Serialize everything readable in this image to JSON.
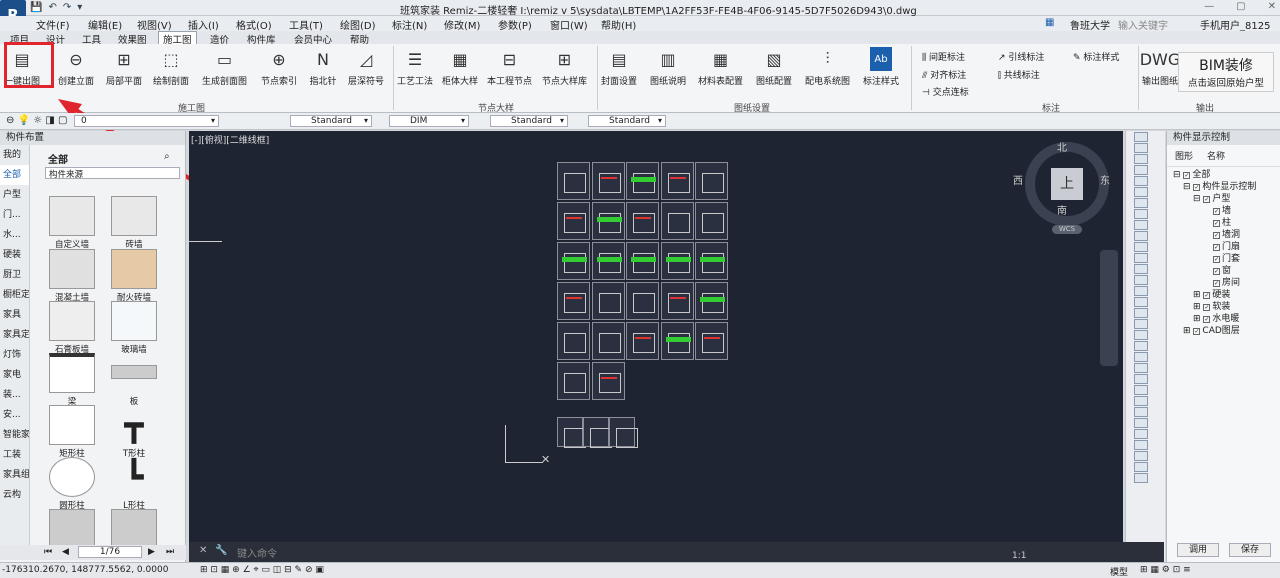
{
  "app": {
    "title": "班筑家装 Remiz-二楼轻奢    I:\\remiz v 5\\sysdata\\LBTEMP\\1A2FF53F-FE4B-4F06-9145-5D7F5026D943\\0.dwg",
    "logo": "R"
  },
  "menus": [
    "文件(F)",
    "编辑(E)",
    "视图(V)",
    "插入(I)",
    "格式(O)",
    "工具(T)",
    "绘图(D)",
    "标注(N)",
    "修改(M)",
    "参数(P)",
    "窗口(W)",
    "帮助(H)"
  ],
  "top_right": {
    "school": "鲁班大学",
    "search_placeholder": "输入关键字",
    "user": "手机用户_8125"
  },
  "tabs": [
    "项目",
    "设计",
    "工具",
    "效果图",
    "施工图",
    "造价",
    "构件库",
    "会员中心",
    "帮助"
  ],
  "active_tab": "施工图",
  "ribbon": {
    "construction": [
      "一键出图",
      "创建立面",
      "局部平面",
      "绘制剖面",
      "生成剖面图",
      "节点索引",
      "指北针",
      "层深符号"
    ],
    "construction_label": "施工图",
    "node": [
      "工艺工法",
      "柜体大样",
      "本工程节点",
      "节点大样库"
    ],
    "node_label": "节点大样",
    "drawing_settings": [
      "封面设置",
      "图纸说明",
      "材料表配置",
      "图纸配置",
      "配电系统图",
      "标注样式"
    ],
    "drawing_settings_label": "图纸设置",
    "annotate": [
      "间距标注",
      "对齐标注",
      "交点连标",
      "引线标注",
      "共线标注",
      "标注样式"
    ],
    "annotate_label": "标注",
    "output": [
      "输出图纸"
    ],
    "output_label": "输出"
  },
  "bim_tip": {
    "title": "BIM装修",
    "sub": "点击返回原始户型"
  },
  "propbar": {
    "layer": "0",
    "text_style": "Standard",
    "dim_style": "DIM",
    "table_style": "Standard",
    "mleader_style": "Standard"
  },
  "left_panel": {
    "title": "构件布置",
    "categories": [
      "我的",
      "全部",
      "户型",
      "门...",
      "水...",
      "硬装",
      "厨卫",
      "橱柜定制",
      "家具",
      "家具定制",
      "灯饰",
      "家电",
      "装...",
      "安...",
      "智能家居",
      "工装",
      "家具组合",
      "云构"
    ],
    "header": "全部",
    "filter": "构件来源",
    "components": [
      "自定义墙",
      "砖墙",
      "混凝土墙",
      "耐火砖墙",
      "石膏板墙",
      "玻璃墙",
      "梁",
      "板",
      "矩形柱",
      "T形柱",
      "圆形柱",
      "L形柱",
      "",
      ""
    ],
    "page": "1/76"
  },
  "canvas": {
    "label": "[-][俯视][二维线框]"
  },
  "compass": {
    "n": "北",
    "s": "南",
    "e": "东",
    "w": "西",
    "center": "上",
    "wcs": "WCS"
  },
  "right_panel": {
    "title": "构件显示控制",
    "cols": [
      "图形",
      "名称"
    ],
    "tree": [
      "全部",
      "构件显示控制",
      "户型",
      "墙",
      "柱",
      "墙洞",
      "门扇",
      "门套",
      "窗",
      "房间",
      "硬装",
      "软装",
      "水电暖",
      "CAD图层"
    ],
    "apply": "调用",
    "save": "保存"
  },
  "cmd": {
    "placeholder": "键入命令"
  },
  "status": {
    "coords": "-176310.2670, 148777.5562, 0.0000",
    "model": "模型",
    "scale": "1:1"
  }
}
